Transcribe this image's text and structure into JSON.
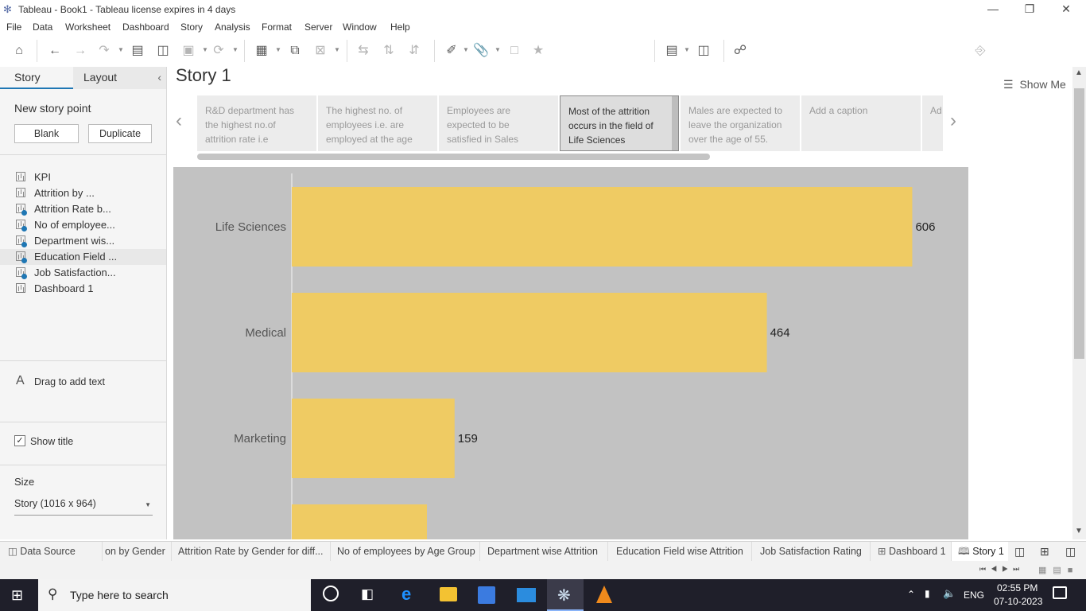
{
  "window": {
    "title": "Tableau - Book1 - Tableau license expires in 4 days"
  },
  "menu": [
    "File",
    "Data",
    "Worksheet",
    "Dashboard",
    "Story",
    "Analysis",
    "Format",
    "Server",
    "Window",
    "Help"
  ],
  "toolbar": {
    "show_me": "Show Me"
  },
  "left_pane": {
    "tabs": {
      "story": "Story",
      "layout": "Layout"
    },
    "new_story_point": "New story point",
    "blank_button": "Blank",
    "duplicate_button": "Duplicate",
    "sheets": [
      {
        "label": "KPI",
        "type": "worksheet",
        "used": false
      },
      {
        "label": "Attrition by ...",
        "type": "worksheet",
        "used": false
      },
      {
        "label": "Attrition Rate b...",
        "type": "worksheet",
        "used": true
      },
      {
        "label": "No of employee...",
        "type": "worksheet",
        "used": true
      },
      {
        "label": "Department wis...",
        "type": "worksheet",
        "used": true
      },
      {
        "label": "Education Field ...",
        "type": "worksheet",
        "used": true
      },
      {
        "label": "Job Satisfaction...",
        "type": "worksheet",
        "used": true
      },
      {
        "label": "Dashboard 1",
        "type": "dashboard",
        "used": false
      }
    ],
    "drag_text": "Drag to add text",
    "show_title": "Show title",
    "size_label": "Size",
    "size_value": "Story (1016 x 964)"
  },
  "story": {
    "title": "Story 1",
    "points": [
      {
        "lines": [
          "R&D department has",
          "the highest no.of",
          "attrition rate  i.e"
        ],
        "active": false
      },
      {
        "lines": [
          "The highest no. of",
          "employees i.e. are",
          "employed at the age"
        ],
        "active": false
      },
      {
        "lines": [
          "Employees are",
          "expected to be",
          "satisfied in Sales"
        ],
        "active": false
      },
      {
        "lines": [
          "Most of the attrition",
          "occurs  in the field of",
          "Life Sciences"
        ],
        "active": true
      },
      {
        "lines": [
          "Males are expected to",
          "leave the organization",
          "over the age of 55."
        ],
        "active": false
      },
      {
        "lines": [
          "Add a caption"
        ],
        "active": false
      },
      {
        "lines": [
          "Ad"
        ],
        "active": false
      }
    ]
  },
  "chart_data": {
    "type": "bar",
    "orientation": "horizontal",
    "categories": [
      "Life Sciences",
      "Medical",
      "Marketing",
      ""
    ],
    "values": [
      606,
      464,
      159,
      132
    ],
    "labels": [
      "606",
      "464",
      "159",
      ""
    ],
    "bar_color": "#EFCB63",
    "background": "#C2C2C2",
    "xlim": [
      0,
      660
    ]
  },
  "sheet_tabs": [
    {
      "label": "Data Source",
      "icon": "database-icon",
      "active": false
    },
    {
      "label": "on by Gender",
      "icon": "",
      "active": false
    },
    {
      "label": "Attrition Rate by Gender for diff...",
      "icon": "",
      "active": false
    },
    {
      "label": "No of employees by Age Group",
      "icon": "",
      "active": false
    },
    {
      "label": "Department wise Attrition",
      "icon": "",
      "active": false
    },
    {
      "label": "Education Field wise Attrition",
      "icon": "",
      "active": false
    },
    {
      "label": "Job Satisfaction Rating",
      "icon": "",
      "active": false
    },
    {
      "label": "Dashboard 1",
      "icon": "dashboard-icon",
      "active": false
    },
    {
      "label": "Story 1",
      "icon": "story-icon",
      "active": true
    }
  ],
  "taskbar": {
    "search_placeholder": "Type here to search",
    "language": "ENG",
    "time": "02:55 PM",
    "date": "07-10-2023"
  }
}
